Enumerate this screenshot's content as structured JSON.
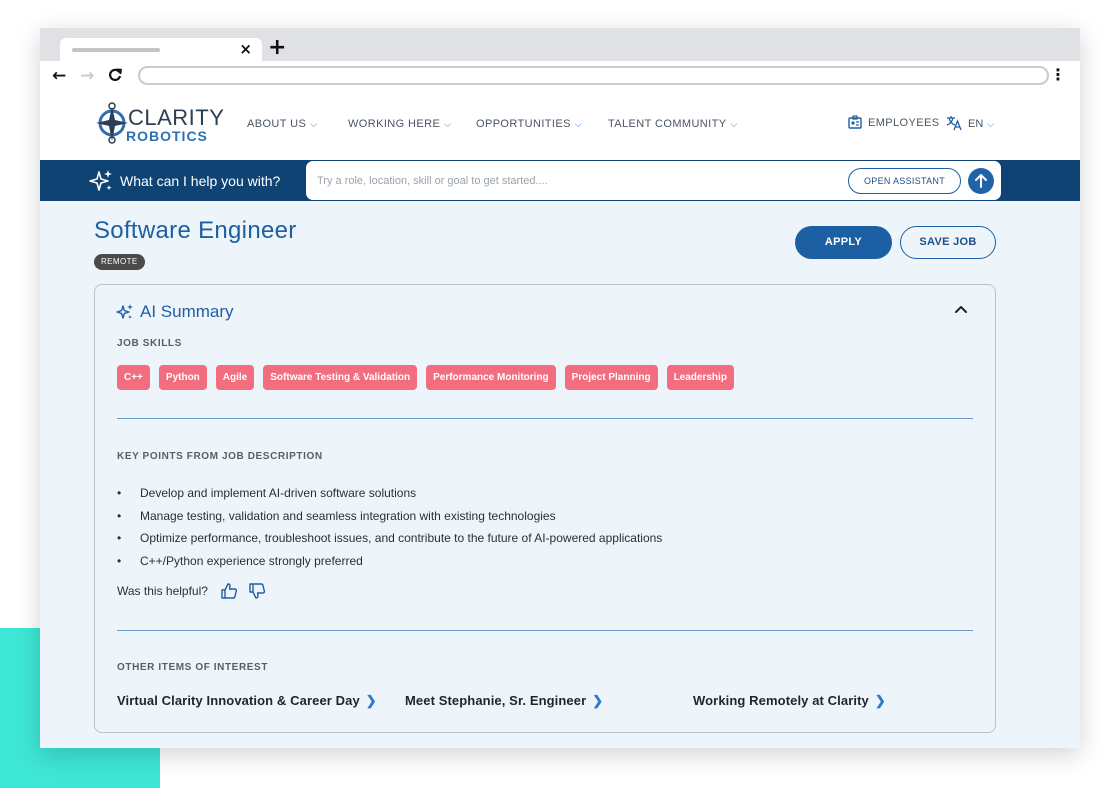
{
  "browser": {
    "tab_close": "×",
    "new_tab": "+",
    "back": "←",
    "forward": "→",
    "reload": "C",
    "menu": "⋮"
  },
  "header": {
    "logo_line1": "CLARITY",
    "logo_line2": "ROBOTICS",
    "nav": [
      {
        "label": "ABOUT US"
      },
      {
        "label": "WORKING HERE"
      },
      {
        "label": "OPPORTUNITIES"
      },
      {
        "label": "TALENT COMMUNITY"
      }
    ],
    "employees_label": "EMPLOYEES",
    "language": "EN"
  },
  "assistant": {
    "prompt": "What can I help you with?",
    "placeholder": "Try a role, location, skill or goal to get started....",
    "open_label": "OPEN ASSISTANT"
  },
  "job": {
    "title": "Software Engineer",
    "badge": "REMOTE",
    "apply_label": "APPLY",
    "save_label": "SAVE JOB"
  },
  "summary": {
    "title": "AI Summary",
    "skills_heading": "JOB SKILLS",
    "skills": [
      "C++",
      "Python",
      "Agile",
      "Software Testing & Validation",
      "Performance Monitoring",
      "Project Planning",
      "Leadership"
    ],
    "key_points_heading": "KEY POINTS FROM JOB DESCRIPTION",
    "key_points": [
      "Develop and implement AI-driven software solutions",
      "Manage testing, validation and seamless integration with existing technologies",
      "Optimize performance, troubleshoot issues, and contribute to the future of AI-powered applications",
      "C++/Python experience strongly preferred"
    ],
    "helpful_prompt": "Was this helpful?",
    "other_heading": "OTHER ITEMS OF INTEREST",
    "other_items": [
      {
        "label": "Virtual Clarity Innovation & Career Day"
      },
      {
        "label": "Meet Stephanie, Sr. Engineer"
      },
      {
        "label": "Working Remotely at Clarity"
      }
    ]
  },
  "colors": {
    "brand_blue": "#1d5fa3",
    "assistant_bar": "#0f4374",
    "chip": "#f26d7d",
    "teal_accent": "#3ee6d6"
  },
  "icons": [
    "sparkle-icon",
    "id-badge-icon",
    "translate-icon",
    "arrow-up-icon",
    "chevron-up-icon",
    "thumbs-up-icon",
    "thumbs-down-icon",
    "chevron-right-icon",
    "chevron-down-icon"
  ]
}
